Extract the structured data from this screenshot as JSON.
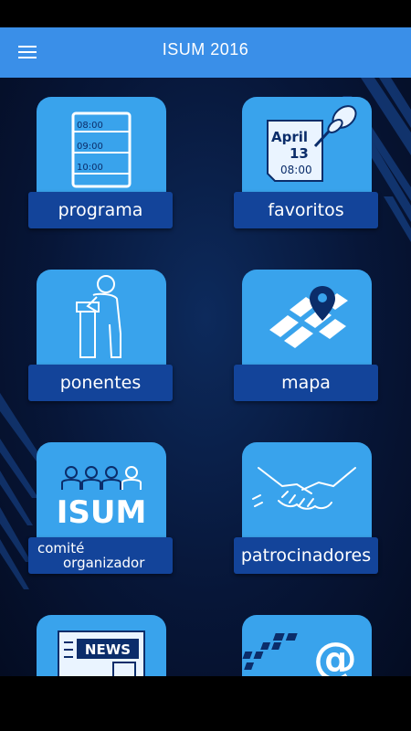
{
  "app_bar": {
    "title": "ISUM 2016",
    "menu_icon": "hamburger-menu-icon",
    "color": "#3a8fe8"
  },
  "tiles": [
    {
      "id": "programa",
      "label": "programa",
      "icon": "schedule-list-icon",
      "times": [
        "08:00",
        "09:00",
        "10:00"
      ]
    },
    {
      "id": "favoritos",
      "label": "favoritos",
      "icon": "pinned-calendar-icon",
      "month": "April",
      "day": "13",
      "time": "08:00"
    },
    {
      "id": "ponentes",
      "label": "ponentes",
      "icon": "speaker-podium-icon"
    },
    {
      "id": "mapa",
      "label": "mapa",
      "icon": "map-pin-icon"
    },
    {
      "id": "comite",
      "label_line1": "comité",
      "label_line2": "organizador",
      "icon": "team-logo-icon",
      "logo_text": "ISUM"
    },
    {
      "id": "patrocinadores",
      "label": "patrocinadores",
      "icon": "handshake-icon"
    },
    {
      "id": "noticias",
      "icon": "newspaper-icon",
      "news_text": "NEWS"
    },
    {
      "id": "contacto",
      "icon": "at-sign-icon",
      "at_symbol": "@"
    }
  ],
  "colors": {
    "tile_top": "#39a3ec",
    "tile_bar": "#13449a",
    "background": "#071638"
  }
}
